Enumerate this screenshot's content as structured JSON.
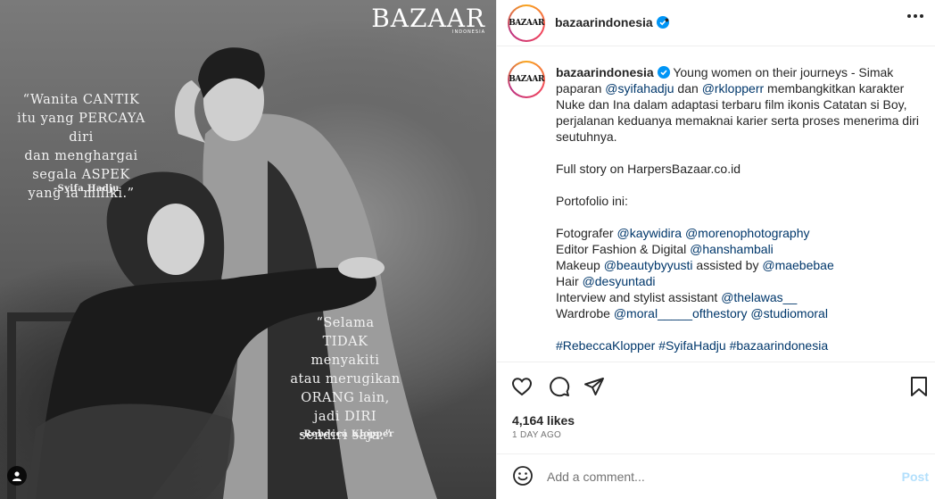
{
  "image": {
    "magazine_name": "BAZAAR",
    "magazine_edition": "INDONESIA",
    "quote1_text": "“Wanita CANTIK\nitu yang PERCAYA diri\ndan menghargai\nsegala ASPEK\nyang ia miliki.”",
    "quote1_author": "-Syifa Hadju",
    "quote2_text": "“Selama\nTIDAK menyakiti\natau merugikan\nORANG lain,\njadi DIRI\nsendiri saja.”",
    "quote2_author": "-Rebecca Klopper"
  },
  "header": {
    "avatar_text": "BAZAAR",
    "username": "bazaarindonesia",
    "dot": "•"
  },
  "caption": {
    "username": "bazaarindonesia",
    "lines": [
      {
        "a": " Young women on their journeys - Simak paparan "
      },
      {
        "link1": "@syifahadju"
      },
      {
        "b": " dan "
      },
      {
        "link2": "@rklopperr"
      },
      {
        "c": " membangkitkan karakter Nuke dan Ina dalam adaptasi terbaru film ikonis Catatan si Boy, perjalanan keduanya memaknai karier serta proses menerima diri seutuhnya."
      }
    ],
    "intro_a": " Young women on their journeys - Simak paparan ",
    "intro_link1": "@syifahadju",
    "intro_b": " dan ",
    "intro_link2": "@rklopperr",
    "intro_c": " membangkitkan karakter Nuke dan Ina dalam adaptasi terbaru film ikonis Catatan si Boy, perjalanan keduanya memaknai karier serta proses menerima diri seutuhnya.",
    "full_story": "Full story on HarpersBazaar.co.id",
    "portfolio": "Portofolio ini:",
    "photographer_label": "Fotografer ",
    "photographer_1": "@kaywidira",
    "photographer_2": "@morenophotography",
    "editor_label": "Editor Fashion & Digital ",
    "editor": "@hanshambali",
    "makeup_label": "Makeup ",
    "makeup_1": "@beautybyyusti",
    "makeup_mid": " assisted by ",
    "makeup_2": "@maebebae",
    "hair_label": "Hair ",
    "hair": "@desyuntadi",
    "interview_label": "Interview and stylist assistant ",
    "interview": "@thelawas__",
    "wardrobe_label": "Wardrobe ",
    "wardrobe_1": "@moral_____ofthestory",
    "wardrobe_2": "@studiomoral",
    "hashtag_1": "#RebeccaKlopper",
    "hashtag_2": "#SyifaHadju",
    "hashtag_3": "#bazaarindonesia"
  },
  "stats": {
    "likes": "4,164 likes",
    "time": "1 DAY AGO"
  },
  "comment": {
    "placeholder": "Add a comment...",
    "post_label": "Post"
  },
  "colors": {
    "link": "#00376b",
    "verified": "#0095f6",
    "post_disabled": "#b2dffc"
  }
}
